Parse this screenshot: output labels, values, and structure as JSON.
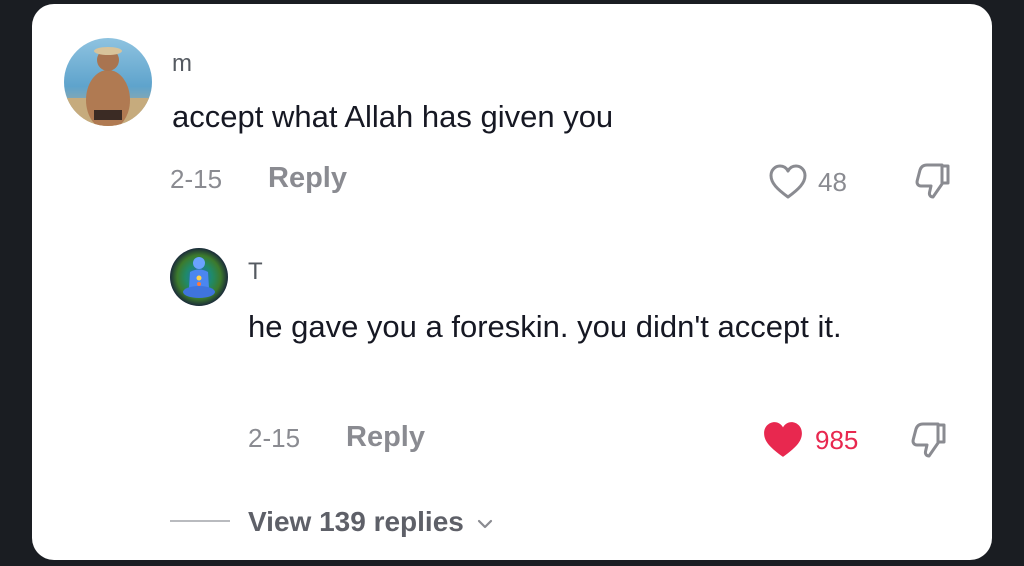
{
  "comments": [
    {
      "username": "m",
      "text": "accept what Allah has given you",
      "date": "2-15",
      "reply_label": "Reply",
      "likes": "48",
      "liked": false,
      "avatar_icon": "photo-avatar-icon"
    },
    {
      "username": "T",
      "text": "he gave you a foreskin. you didn't accept it.",
      "date": "2-15",
      "reply_label": "Reply",
      "likes": "985",
      "liked": true,
      "avatar_icon": "meditation-avatar-icon"
    }
  ],
  "view_replies": "View 139 replies",
  "colors": {
    "card": "#ffffff",
    "background": "#1a1d22",
    "liked_heart": "#e8284f",
    "muted_text": "#8a8b91"
  },
  "icons": [
    "heart-icon",
    "dislike-icon",
    "chevron-down-icon"
  ]
}
